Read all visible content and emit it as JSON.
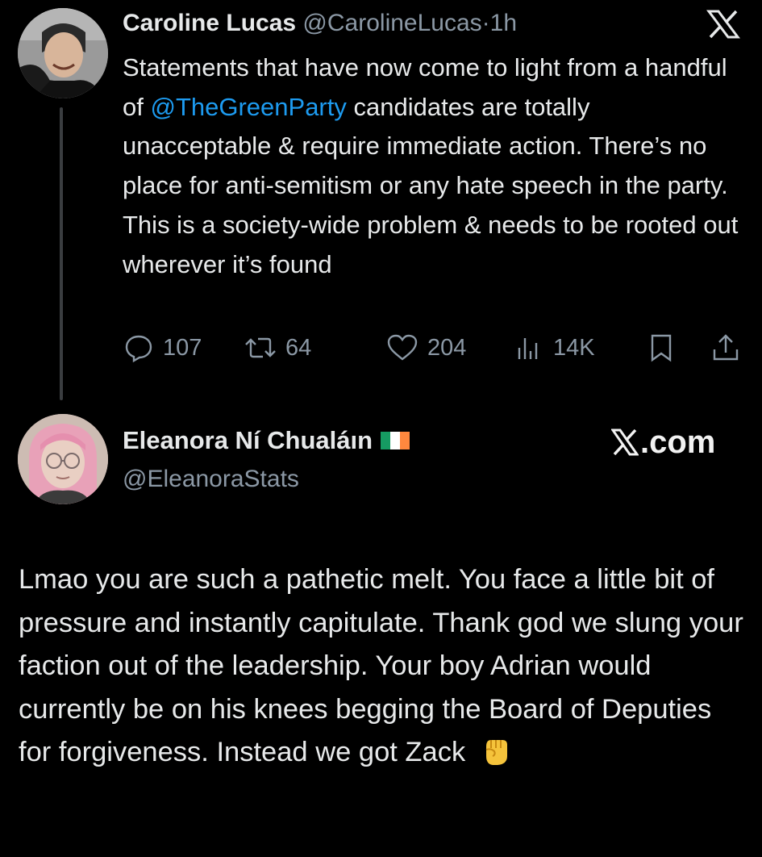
{
  "tweet": {
    "author": {
      "name": "Caroline Lucas",
      "handle": "@CarolineLucas",
      "dot": "·",
      "time": "1h"
    },
    "text_before_mention": "Statements that have now come to light from a handful of ",
    "mention": "@TheGreenParty",
    "text_after_mention": " candidates are totally unacceptable & require immediate action. There’s no place for anti-semitism or any hate speech in the party. This is a society-wide problem & needs to be rooted out wherever it’s found",
    "stats": {
      "replies": "107",
      "reposts": "64",
      "likes": "204",
      "views": "14K"
    }
  },
  "reply": {
    "author": {
      "name": "Eleanora Ní Chualáın",
      "handle": "@EleanoraStats",
      "flag": "Ireland flag",
      "flag_colors": [
        "#169b62",
        "#ffffff",
        "#ff883e"
      ]
    },
    "text": "Lmao you are such a pathetic melt. You face a little bit of pressure and instantly capitulate. Thank god we slung your faction out of the leadership. Your boy Adrian would currently be on his knees begging the Board of Deputies for forgiveness. Instead we got Zack",
    "emoji": "raised-fist"
  },
  "branding": {
    "site": ".com"
  },
  "colors": {
    "background": "#000000",
    "text": "#e7e9ea",
    "muted": "#8b98a5",
    "link": "#1d9bf0"
  },
  "icons": [
    "x-logo-icon",
    "reply-icon",
    "repost-icon",
    "like-icon",
    "views-icon",
    "bookmark-icon",
    "share-icon"
  ]
}
